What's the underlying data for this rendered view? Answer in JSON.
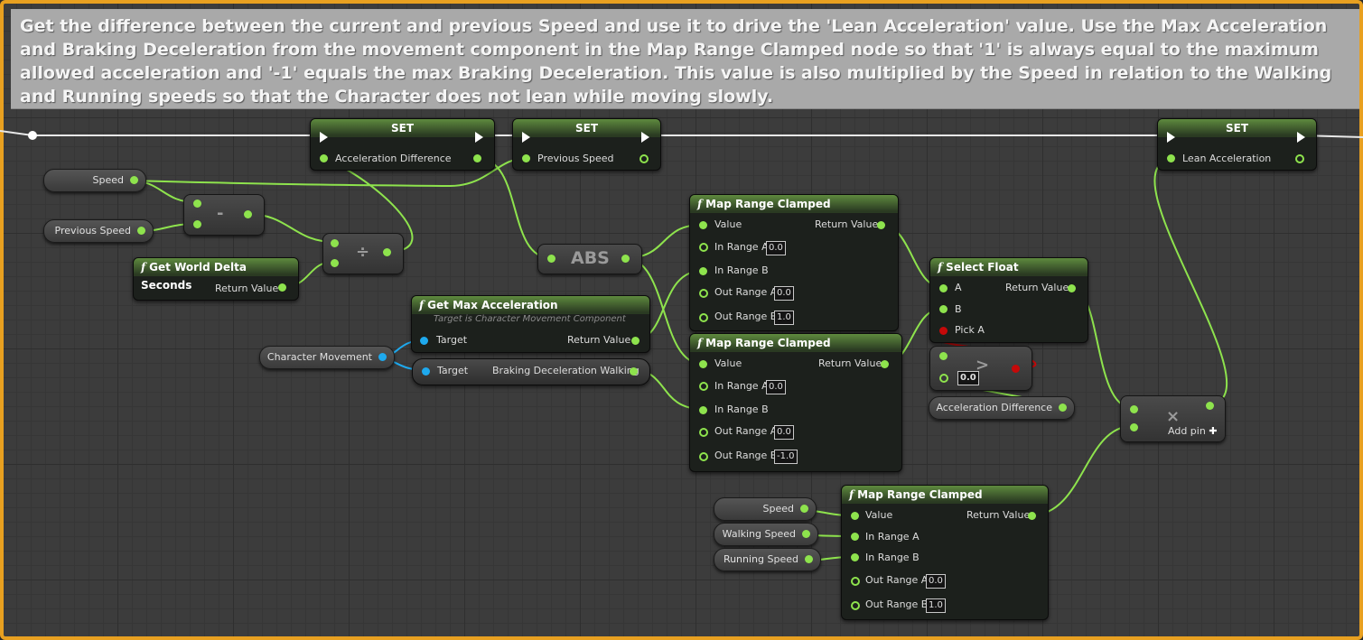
{
  "comment": "Get the difference between the current and previous Speed and use it to drive the 'Lean Acceleration' value. Use the Max Acceleration and Braking Deceleration from the movement component in the Map Range Clamped node so that '1' is always equal to the maximum allowed acceleration and '-1' equals the max Braking Deceleration. This value is also multiplied by the Speed in relation to the Walking and Running speeds so that the Character does not lean while moving slowly.",
  "colors": {
    "frame": "#e8a020",
    "float_pin": "#8ee34d",
    "object_pin": "#1ea9ee",
    "bool_pin": "#c50909"
  },
  "nodes": {
    "set1": {
      "title": "SET",
      "pin": "Acceleration Difference"
    },
    "set2": {
      "title": "SET",
      "pin": "Previous Speed"
    },
    "set3": {
      "title": "SET",
      "pin": "Lean Acceleration"
    },
    "speed_var": "Speed",
    "prev_speed_var": "Previous Speed",
    "subtract": "-",
    "divide": "÷",
    "delta": {
      "title": "Get World Delta Seconds",
      "out": "Return Value"
    },
    "abs": "ABS",
    "max_accel": {
      "title": "Get Max Acceleration",
      "subtitle": "Target is Character Movement Component",
      "in": "Target",
      "out": "Return Value"
    },
    "char_move": "Character Movement",
    "braking": {
      "in": "Target",
      "out": "Braking Deceleration Walking"
    },
    "mrc1": {
      "title": "Map Range Clamped",
      "value": "Value",
      "ret": "Return Value",
      "ira": "In Range A",
      "ira_v": "0.0",
      "irb": "In Range B",
      "ora": "Out Range A",
      "ora_v": "0.0",
      "orb": "Out Range B",
      "orb_v": "1.0"
    },
    "mrc2": {
      "title": "Map Range Clamped",
      "value": "Value",
      "ret": "Return Value",
      "ira": "In Range A",
      "ira_v": "0.0",
      "irb": "In Range B",
      "ora": "Out Range A",
      "ora_v": "0.0",
      "orb": "Out Range B",
      "orb_v": "-1.0"
    },
    "mrc3": {
      "title": "Map Range Clamped",
      "value": "Value",
      "ret": "Return Value",
      "ira": "In Range A",
      "irb": "In Range B",
      "ora": "Out Range A",
      "ora_v": "0.0",
      "orb": "Out Range B",
      "orb_v": "1.0"
    },
    "select": {
      "title": "Select Float",
      "a": "A",
      "b": "B",
      "pick": "Pick A",
      "ret": "Return Value"
    },
    "greater": {
      "symbol": ">",
      "value": "0.0"
    },
    "accel_diff_var": "Acceleration Difference",
    "multiply": {
      "symbol": "×",
      "add_pin": "Add pin",
      "plus": "✚"
    },
    "speed_var2": "Speed",
    "walking_var": "Walking Speed",
    "running_var": "Running Speed"
  }
}
